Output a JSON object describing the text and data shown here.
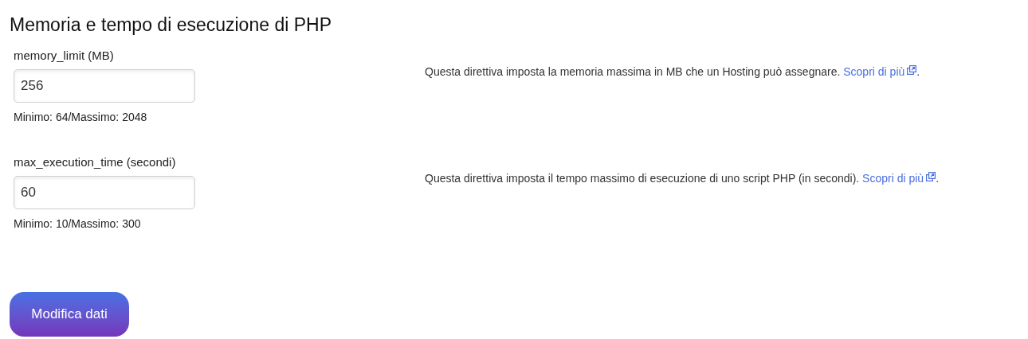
{
  "title": "Memoria e tempo di esecuzione di PHP",
  "fields": [
    {
      "label": "memory_limit (MB)",
      "value": "256",
      "hint": "Minimo: 64/Massimo: 2048",
      "description": "Questa direttiva imposta la memoria massima in MB che un Hosting può assegnare.",
      "link": "Scopri di più",
      "after_link": "."
    },
    {
      "label": "max_execution_time (secondi)",
      "value": "60",
      "hint": "Minimo: 10/Massimo: 300",
      "description": "Questa direttiva imposta il tempo massimo di esecuzione di uno script PHP (in secondi).",
      "link": "Scopri di più",
      "after_link": "."
    }
  ],
  "submit": "Modifica dati"
}
